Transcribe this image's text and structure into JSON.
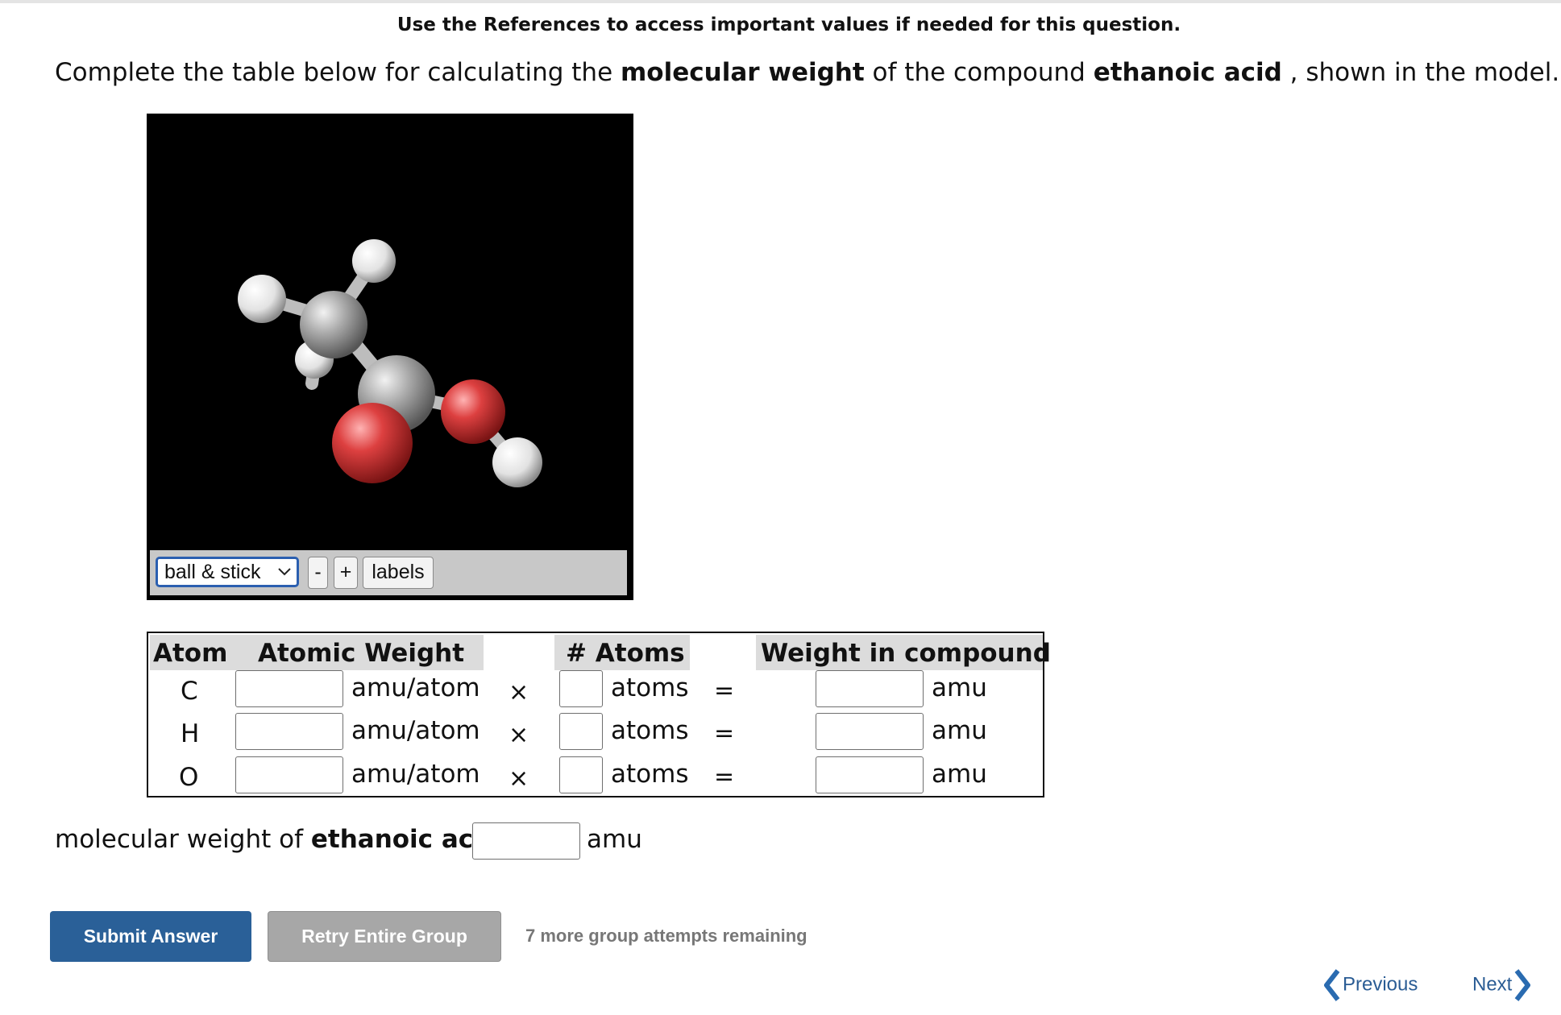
{
  "header": {
    "reference_note": "Use the References to access important values if needed for this question."
  },
  "question": {
    "prompt_part1": "Complete the table below for calculating the ",
    "prompt_bold1": "molecular weight",
    "prompt_part2": " of the compound ",
    "prompt_bold2": "ethanoic acid",
    "prompt_part3": " , shown in the model."
  },
  "viewer": {
    "model_select_value": "ball & stick",
    "zoom_out_label": "-",
    "zoom_in_label": "+",
    "labels_button": "labels",
    "atom_colors": {
      "carbon": "#9a9a9a",
      "hydrogen": "#f2f2f2",
      "oxygen": "#d93a3a",
      "background": "#000000"
    }
  },
  "table": {
    "headers": {
      "atom": "Atom",
      "atomic_weight": "Atomic Weight",
      "num_atoms": "# Atoms",
      "weight_in_compound": "Weight in compound"
    },
    "rows": [
      {
        "atom": "C",
        "atomic_weight_value": "",
        "aw_unit": "amu/atom",
        "times": "×",
        "atoms_value": "",
        "atoms_unit": "atoms",
        "equals": "=",
        "weight_value": "",
        "weight_unit": "amu"
      },
      {
        "atom": "H",
        "atomic_weight_value": "",
        "aw_unit": "amu/atom",
        "times": "×",
        "atoms_value": "",
        "atoms_unit": "atoms",
        "equals": "=",
        "weight_value": "",
        "weight_unit": "amu"
      },
      {
        "atom": "O",
        "atomic_weight_value": "",
        "aw_unit": "amu/atom",
        "times": "×",
        "atoms_value": "",
        "atoms_unit": "atoms",
        "equals": "=",
        "weight_value": "",
        "weight_unit": "amu"
      }
    ]
  },
  "molecular_weight": {
    "label_part1": "molecular weight of ",
    "label_bold": "ethanoic acid",
    "label_equals": " =",
    "value": "",
    "unit": "amu"
  },
  "actions": {
    "submit_label": "Submit Answer",
    "retry_label": "Retry Entire Group",
    "attempts_text": "7 more group attempts remaining"
  },
  "navigation": {
    "previous_label": "Previous",
    "next_label": "Next"
  }
}
